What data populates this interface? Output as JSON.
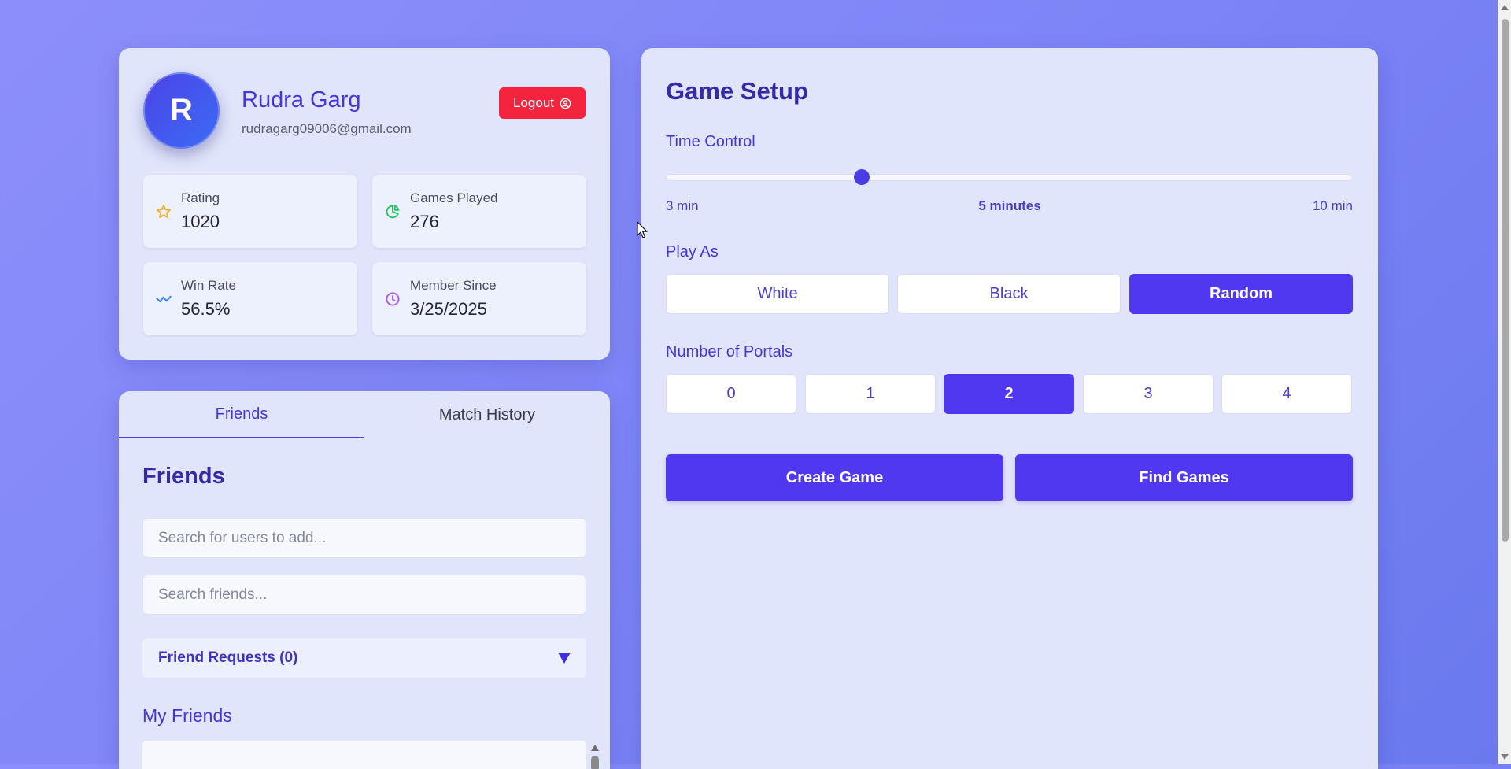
{
  "profile": {
    "avatar_initial": "R",
    "name": "Rudra Garg",
    "email": "rudragarg09006@gmail.com",
    "logout_label": "Logout",
    "stats": [
      {
        "label": "Rating",
        "value": "1020",
        "icon": "star-icon",
        "color": "#f2b01e"
      },
      {
        "label": "Games Played",
        "value": "276",
        "icon": "pie-chart-icon",
        "color": "#22c55e"
      },
      {
        "label": "Win Rate",
        "value": "56.5%",
        "icon": "trend-icon",
        "color": "#3b82f6"
      },
      {
        "label": "Member Since",
        "value": "3/25/2025",
        "icon": "clock-icon",
        "color": "#a855f7"
      }
    ]
  },
  "social": {
    "tabs": [
      {
        "label": "Friends",
        "active": true
      },
      {
        "label": "Match History",
        "active": false
      }
    ],
    "title": "Friends",
    "search_users_placeholder": "Search for users to add...",
    "search_friends_placeholder": "Search friends...",
    "requests_label": "Friend Requests (0)",
    "my_friends_title": "My Friends"
  },
  "game_setup": {
    "title": "Game Setup",
    "time_control": {
      "label": "Time Control",
      "min_label": "3 min",
      "max_label": "10 min",
      "current_label": "5 minutes",
      "value": 5,
      "min": 3,
      "max": 10
    },
    "play_as": {
      "label": "Play As",
      "options": [
        "White",
        "Black",
        "Random"
      ],
      "selected": "Random"
    },
    "portals": {
      "label": "Number of Portals",
      "options": [
        "0",
        "1",
        "2",
        "3",
        "4"
      ],
      "selected": "2"
    },
    "create_label": "Create Game",
    "find_label": "Find Games"
  },
  "colors": {
    "accent": "#4f38ef",
    "logout": "#f4233e",
    "heading": "#362aa8"
  }
}
